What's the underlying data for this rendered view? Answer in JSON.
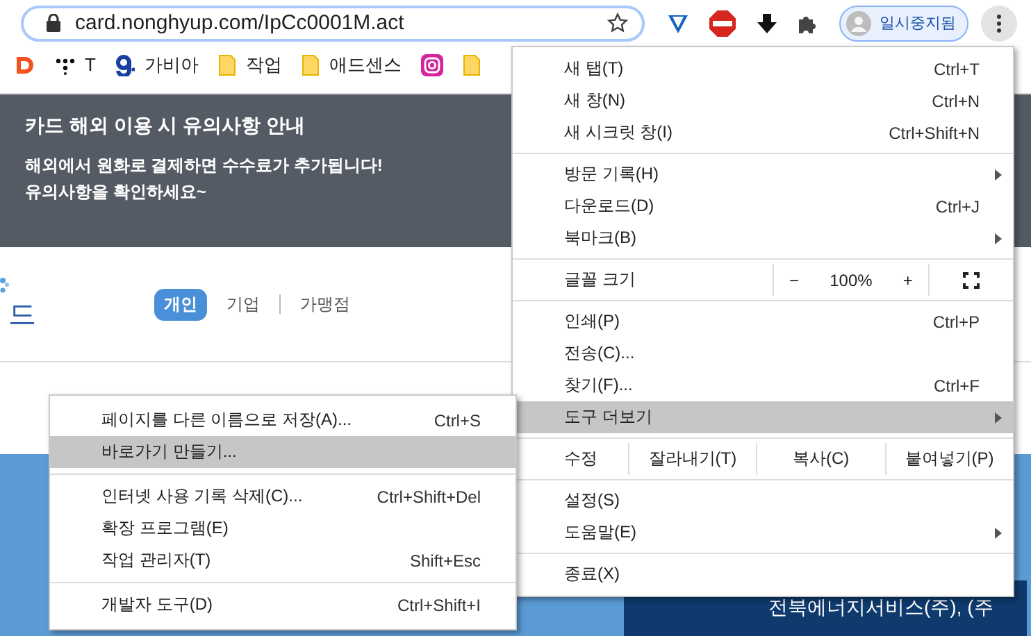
{
  "toolbar": {
    "url": "card.nonghyup.com/IpCc0001M.act",
    "profile_label": "일시중지됨"
  },
  "bookmarks": [
    {
      "kind": "app"
    },
    {
      "kind": "dots",
      "label": "T"
    },
    {
      "kind": "g",
      "label": "가비아"
    },
    {
      "kind": "folder",
      "label": "작업"
    },
    {
      "kind": "folder",
      "label": "애드센스"
    },
    {
      "kind": "camera"
    },
    {
      "kind": "folder"
    }
  ],
  "banner": {
    "title": "카드 해외 이용 시 유의사항 안내",
    "lines": [
      "해외에서 원화로 결제하면 수수료가 추가됩니다!",
      "유의사항을 확인하세요~"
    ]
  },
  "site_header": {
    "logo_text": "드",
    "tabs": [
      {
        "label": "개인",
        "selected": true
      },
      {
        "label": "기업",
        "selected": false
      },
      {
        "label": "가맹점",
        "selected": false
      }
    ]
  },
  "footer_box": {
    "text": "전북에너지서비스(주), (주"
  },
  "menu": [
    {
      "kind": "item",
      "label": "새 탭(T)",
      "shortcut": "Ctrl+T",
      "submenu": false,
      "selected": false
    },
    {
      "kind": "item",
      "label": "새 창(N)",
      "shortcut": "Ctrl+N",
      "submenu": false,
      "selected": false
    },
    {
      "kind": "item",
      "label": "새 시크릿 창(I)",
      "shortcut": "Ctrl+Shift+N",
      "submenu": false,
      "selected": false
    },
    {
      "kind": "separator"
    },
    {
      "kind": "item",
      "label": "방문 기록(H)",
      "submenu": true,
      "selected": false
    },
    {
      "kind": "item",
      "label": "다운로드(D)",
      "shortcut": "Ctrl+J",
      "submenu": false,
      "selected": false
    },
    {
      "kind": "item",
      "label": "북마크(B)",
      "submenu": true,
      "selected": false
    },
    {
      "kind": "separator"
    },
    {
      "kind": "zoom",
      "label": "글꼴 크기",
      "minus": "−",
      "value": "100%",
      "plus": "+"
    },
    {
      "kind": "separator"
    },
    {
      "kind": "item",
      "label": "인쇄(P)",
      "shortcut": "Ctrl+P",
      "submenu": false,
      "selected": false
    },
    {
      "kind": "item",
      "label": "전송(C)...",
      "submenu": false,
      "selected": false
    },
    {
      "kind": "item",
      "label": "찾기(F)...",
      "shortcut": "Ctrl+F",
      "submenu": false,
      "selected": false
    },
    {
      "kind": "item",
      "label": "도구 더보기",
      "submenu": true,
      "selected": true
    },
    {
      "kind": "separator"
    },
    {
      "kind": "edit",
      "label": "수정",
      "buttons": [
        "잘라내기(T)",
        "복사(C)",
        "붙여넣기(P)"
      ]
    },
    {
      "kind": "separator"
    },
    {
      "kind": "item",
      "label": "설정(S)",
      "submenu": false,
      "selected": false
    },
    {
      "kind": "item",
      "label": "도움말(E)",
      "submenu": true,
      "selected": false
    },
    {
      "kind": "separator"
    },
    {
      "kind": "item",
      "label": "종료(X)",
      "submenu": false,
      "selected": false
    }
  ],
  "submenu": [
    {
      "kind": "item",
      "label": "페이지를 다른 이름으로 저장(A)...",
      "shortcut": "Ctrl+S",
      "selected": false
    },
    {
      "kind": "item",
      "label": "바로가기 만들기...",
      "selected": true
    },
    {
      "kind": "separator"
    },
    {
      "kind": "item",
      "label": "인터넷 사용 기록 삭제(C)...",
      "shortcut": "Ctrl+Shift+Del",
      "selected": false
    },
    {
      "kind": "item",
      "label": "확장 프로그램(E)",
      "selected": false
    },
    {
      "kind": "item",
      "label": "작업 관리자(T)",
      "shortcut": "Shift+Esc",
      "selected": false
    },
    {
      "kind": "separator"
    },
    {
      "kind": "item",
      "label": "개발자 도구(D)",
      "shortcut": "Ctrl+Shift+I",
      "selected": false
    }
  ]
}
